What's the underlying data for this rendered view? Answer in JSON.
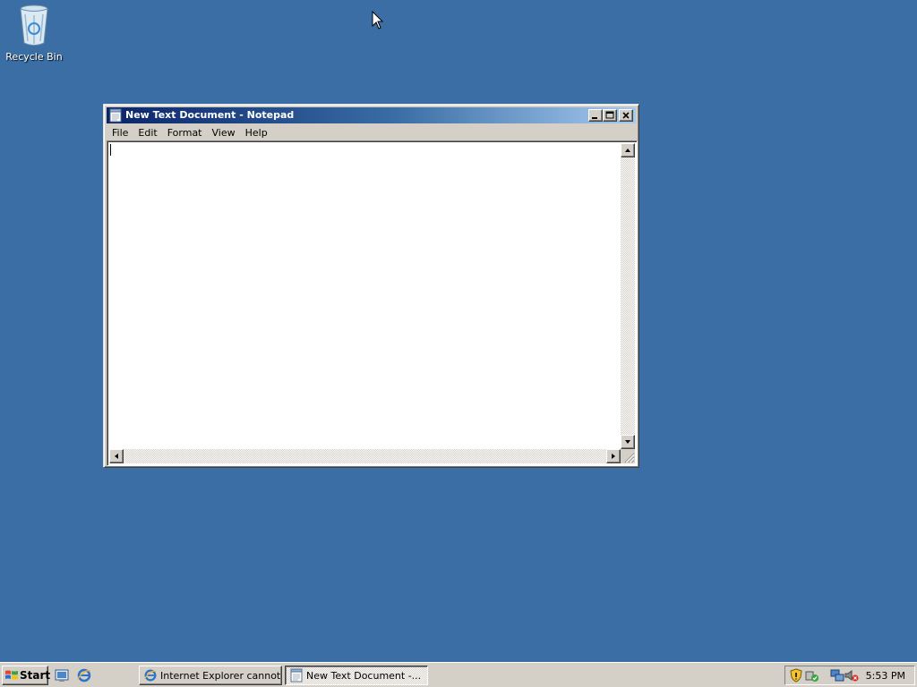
{
  "desktop": {
    "icons": [
      {
        "label": "Recycle Bin",
        "icon": "recycle-bin-icon"
      }
    ],
    "background_color": "#3a6ea5"
  },
  "window": {
    "title": "New Text Document - Notepad",
    "app_icon": "notepad-icon",
    "controls": {
      "minimize": "minimize-icon",
      "maximize": "maximize-icon",
      "close": "close-icon"
    },
    "menu": [
      "File",
      "Edit",
      "Format",
      "View",
      "Help"
    ],
    "content": ""
  },
  "taskbar": {
    "start_label": "Start",
    "quick_launch": [
      "show-desktop-icon",
      "internet-explorer-icon"
    ],
    "buttons": [
      {
        "label": "Internet Explorer cannot...",
        "icon": "internet-explorer-icon",
        "active": false
      },
      {
        "label": "New Text Document -...",
        "icon": "notepad-icon",
        "active": true
      }
    ],
    "tray_icons": [
      "security-shield-icon",
      "update-icon",
      "network-icon",
      "volume-muted-icon"
    ],
    "clock": "5:53 PM"
  }
}
